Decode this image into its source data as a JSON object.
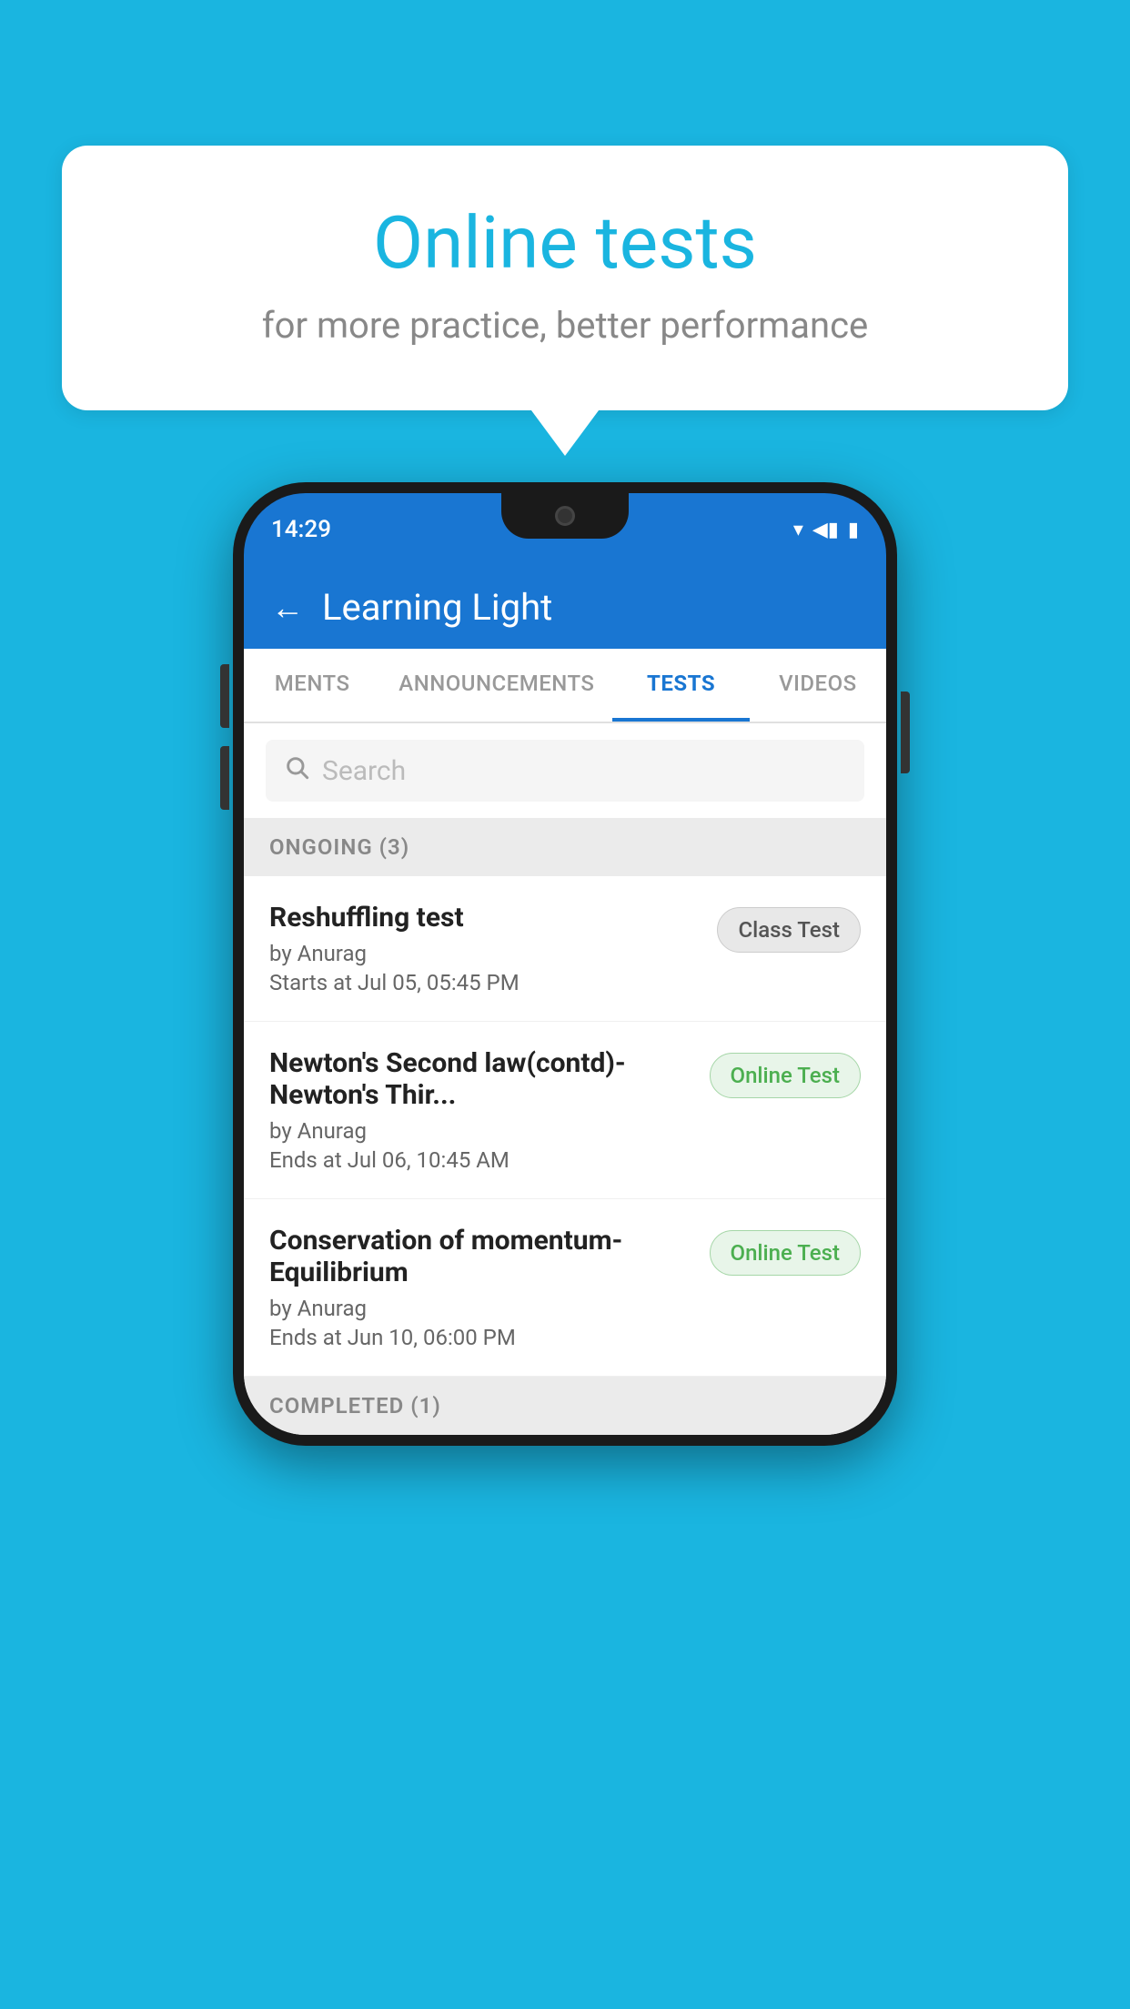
{
  "background_color": "#1ab5e0",
  "speech_bubble": {
    "title": "Online tests",
    "subtitle": "for more practice, better performance"
  },
  "phone": {
    "status_bar": {
      "time": "14:29",
      "wifi": "▾",
      "signal": "▲",
      "battery": "▮"
    },
    "app_bar": {
      "title": "Learning Light",
      "back_label": "←"
    },
    "tabs": [
      {
        "label": "MENTS",
        "active": false
      },
      {
        "label": "ANNOUNCEMENTS",
        "active": false
      },
      {
        "label": "TESTS",
        "active": true
      },
      {
        "label": "VIDEOS",
        "active": false
      }
    ],
    "search": {
      "placeholder": "Search"
    },
    "ongoing_section": {
      "header": "ONGOING (3)",
      "items": [
        {
          "name": "Reshuffling test",
          "author": "by Anurag",
          "date": "Starts at  Jul 05, 05:45 PM",
          "badge": "Class Test",
          "badge_type": "class"
        },
        {
          "name": "Newton's Second law(contd)-Newton's Thir...",
          "author": "by Anurag",
          "date": "Ends at  Jul 06, 10:45 AM",
          "badge": "Online Test",
          "badge_type": "online"
        },
        {
          "name": "Conservation of momentum-Equilibrium",
          "author": "by Anurag",
          "date": "Ends at  Jun 10, 06:00 PM",
          "badge": "Online Test",
          "badge_type": "online"
        }
      ]
    },
    "completed_section": {
      "header": "COMPLETED (1)"
    }
  }
}
